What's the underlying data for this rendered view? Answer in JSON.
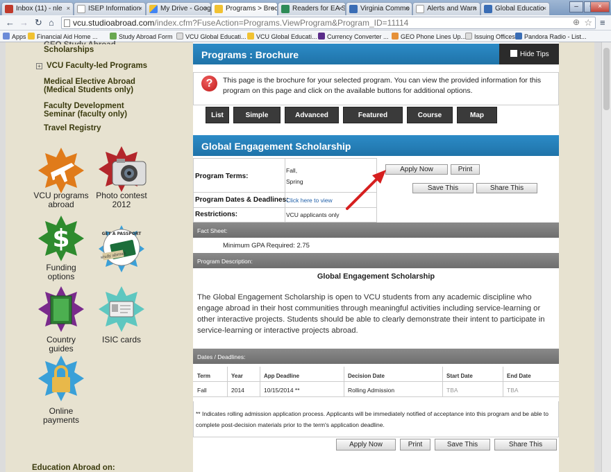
{
  "browser": {
    "tabs": [
      {
        "label": "Inbox (11) - nle",
        "color": "#c0392b"
      },
      {
        "label": "ISEP Information",
        "color": "#ffffff"
      },
      {
        "label": "My Drive - Goog",
        "color": "#f1c232"
      },
      {
        "label": "Programs > Broc",
        "color": "#f1c232",
        "active": true
      },
      {
        "label": "Readers for EA S",
        "color": "#2e8b57"
      },
      {
        "label": "Virginia Commo",
        "color": "#3a6db5"
      },
      {
        "label": "Alerts and Warn",
        "color": "#ffffff"
      },
      {
        "label": "Global Educatio",
        "color": "#3a6db5"
      }
    ],
    "url_host": "vcu.studioabroad.com",
    "url_path": "/index.cfm?FuseAction=Programs.ViewProgram&Program_ID=11114",
    "bookmarks": [
      {
        "label": "Apps",
        "color": "#6c8bd8"
      },
      {
        "label": "Financial Aid Home ...",
        "color": "#f1c232"
      },
      {
        "label": "Study Abroad Form",
        "color": "#6aa84f"
      },
      {
        "label": "VCU Global Educati...",
        "color": "#cccccc"
      },
      {
        "label": "VCU Global Educati...",
        "color": "#f1c232"
      },
      {
        "label": "Currency Converter ...",
        "color": "#5b2c8a"
      },
      {
        "label": "GEO Phone Lines Up...",
        "color": "#e69138"
      },
      {
        "label": "Issuing Offices",
        "color": "#cccccc"
      },
      {
        "label": "Pandora Radio - List...",
        "color": "#3a6db5"
      }
    ]
  },
  "sidebar": {
    "top_cut": "GEO Study Abroad",
    "scholarships": "Scholarships",
    "faculty_led": "VCU Faculty-led Programs",
    "medical": [
      "Medical Elective Abroad",
      "(Medical Students only)"
    ],
    "faculty_dev": [
      "Faculty Development",
      "Seminar (faculty only)"
    ],
    "travel": "Travel Registry",
    "icons": [
      {
        "label1": "VCU programs",
        "label2": "abroad"
      },
      {
        "label1": "Photo contest",
        "label2": "2012"
      },
      {
        "label1": "Funding",
        "label2": "options"
      },
      {
        "label1": "",
        "label2": ""
      },
      {
        "label1": "Country",
        "label2": "guides"
      },
      {
        "label1": "ISIC cards",
        "label2": ""
      },
      {
        "label1": "Online",
        "label2": "payments"
      }
    ],
    "passport_text": "GET A PASSPORT",
    "passport_sub": "study abroad",
    "education_abroad": "Education Abroad on:"
  },
  "main": {
    "title": "Programs : Brochure",
    "hide_tips": "Hide Tips",
    "tip": "This page is the brochure for your selected program. You can view the provided information for this program on this page and click on the available buttons for additional options.",
    "nav_buttons": [
      "List All",
      "Simple Search",
      "Advanced Search",
      "Featured Programs",
      "Course Search",
      "Map Search"
    ],
    "program_title": "Global Engagement Scholarship",
    "terms_label": "Program Terms:",
    "terms": [
      "Fall,",
      "Spring"
    ],
    "dates_label": "Program Dates & Deadlines:",
    "dates_link": "Click here to view",
    "restrictions_label": "Restrictions:",
    "restrictions": "VCU applicants only",
    "buttons": {
      "apply": "Apply Now",
      "print": "Print",
      "save": "Save This",
      "share": "Share This"
    },
    "fact_sheet": "Fact Sheet:",
    "gpa": "Minimum GPA Required:  2.75",
    "description_hdr": "Program Description:",
    "desc_title": "Global Engagement Scholarship",
    "description": "The Global Engagement Scholarship is open to VCU students from any academic discipline who engage abroad in their host communities through meaningful activities including service-learning or other interactive projects.  Students should be able to clearly demonstrate their intent to participate in service-learning or interactive projects abroad.",
    "dates_hdr": "Dates / Deadlines:",
    "columns": [
      "Term",
      "Year",
      "App Deadline",
      "Decision Date",
      "Start Date",
      "End Date"
    ],
    "row": [
      "Fall",
      "2014",
      "10/15/2014 **",
      "Rolling Admission",
      "TBA",
      "TBA"
    ],
    "footnote": "** Indicates rolling admission application process. Applicants will be immediately notified of acceptance into this program and be able to complete post-decision materials prior to the term's application deadline."
  },
  "colors": {
    "accent": "#1f73a8",
    "sidebar_bg": "#e7e2d0",
    "star_orange": "#e07b1a",
    "star_green": "#2e8b2e",
    "star_blue": "#3aa0d8",
    "arrow": "#d61f1f"
  }
}
